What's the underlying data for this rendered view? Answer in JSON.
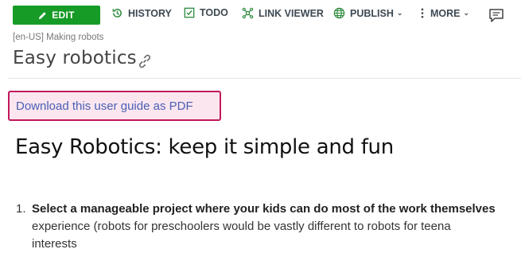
{
  "toolbar": {
    "edit_label": "EDIT",
    "history_label": "HISTORY",
    "todo_label": "TODO",
    "link_viewer_label": "LINK VIEWER",
    "publish_label": "PUBLISH",
    "more_label": "MORE"
  },
  "breadcrumb": "[en-US] Making robots",
  "page_title": "Easy robotics",
  "pdf_link": "Download this user guide as PDF",
  "content": {
    "heading": "Easy Robotics: keep it simple and fun",
    "list": [
      {
        "number": "1.",
        "bold_text": "Select a manageable project where your kids can do most of the work themselves",
        "line2": "experience (robots for preschoolers would be vastly different to robots for teena",
        "line3": "interests"
      }
    ]
  },
  "colors": {
    "edit_green": "#169b27",
    "icon_green": "#2e8b3e",
    "pdf_border": "#c2185b",
    "pdf_bg": "#fbe6f0",
    "link_blue": "#4a60b5"
  }
}
